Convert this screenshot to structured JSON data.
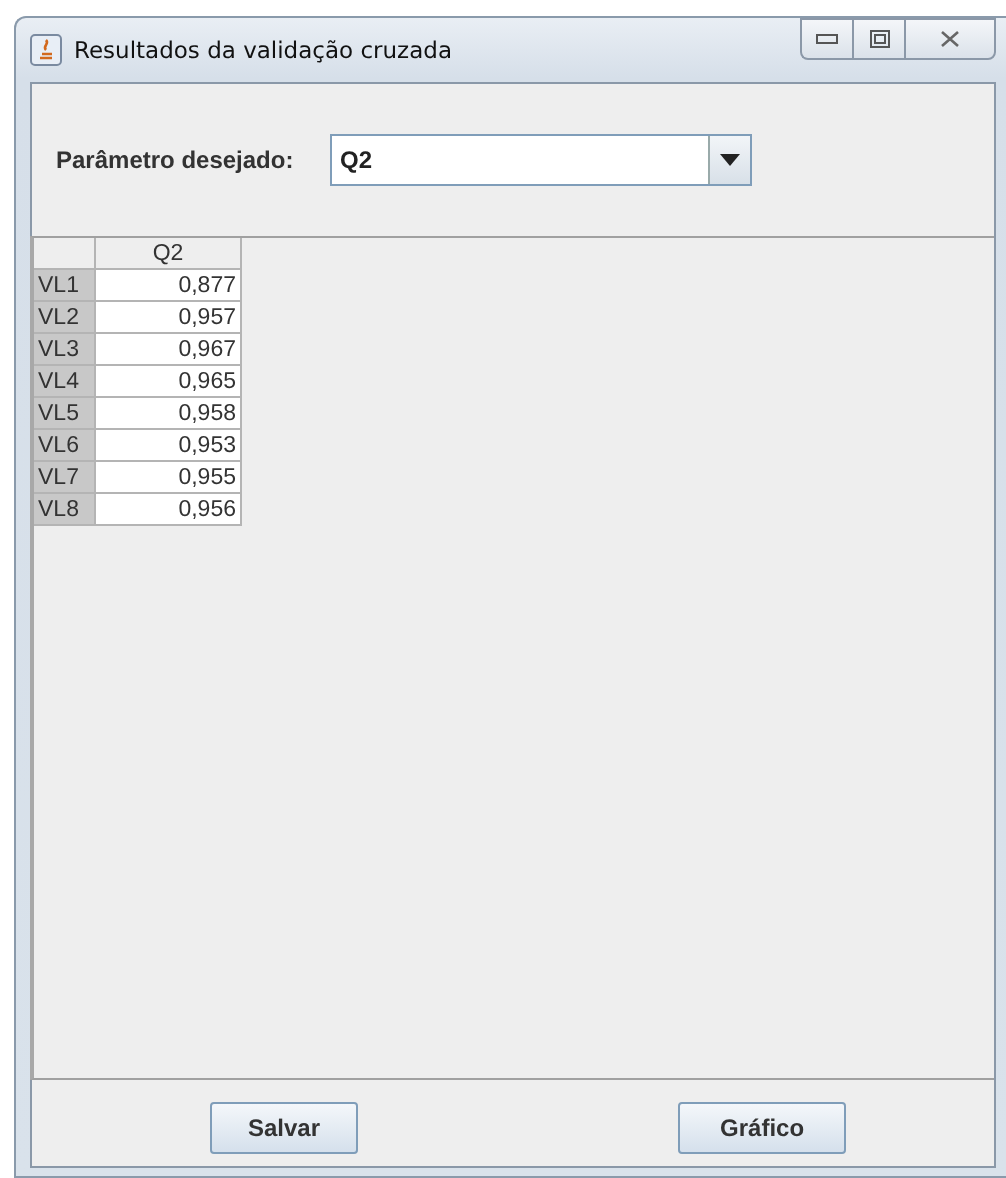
{
  "window": {
    "title": "Resultados da validação cruzada"
  },
  "parameter": {
    "label": "Parâmetro desejado:",
    "value": "Q2"
  },
  "table": {
    "columns": [
      "Q2"
    ],
    "rows": [
      {
        "header": "VL1",
        "value": "0,877"
      },
      {
        "header": "VL2",
        "value": "0,957"
      },
      {
        "header": "VL3",
        "value": "0,967"
      },
      {
        "header": "VL4",
        "value": "0,965"
      },
      {
        "header": "VL5",
        "value": "0,958"
      },
      {
        "header": "VL6",
        "value": "0,953"
      },
      {
        "header": "VL7",
        "value": "0,955"
      },
      {
        "header": "VL8",
        "value": "0,956"
      }
    ]
  },
  "buttons": [
    "Salvar",
    "Gráfico"
  ]
}
